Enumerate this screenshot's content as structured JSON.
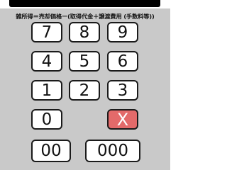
{
  "formula": "雑所得＝売却価格ー(取得代金＋譲渡費用 (手数料等))",
  "keys": {
    "seven": "7",
    "eight": "8",
    "nine": "9",
    "four": "4",
    "five": "5",
    "six": "6",
    "one": "1",
    "two": "2",
    "three": "3",
    "zero": "0",
    "clear": "X",
    "double_zero": "00",
    "triple_zero": "000"
  },
  "colors": {
    "background": "#c9c9c9",
    "key": "#ffffff",
    "clear_key": "#e36a6a",
    "display": "#000000"
  }
}
